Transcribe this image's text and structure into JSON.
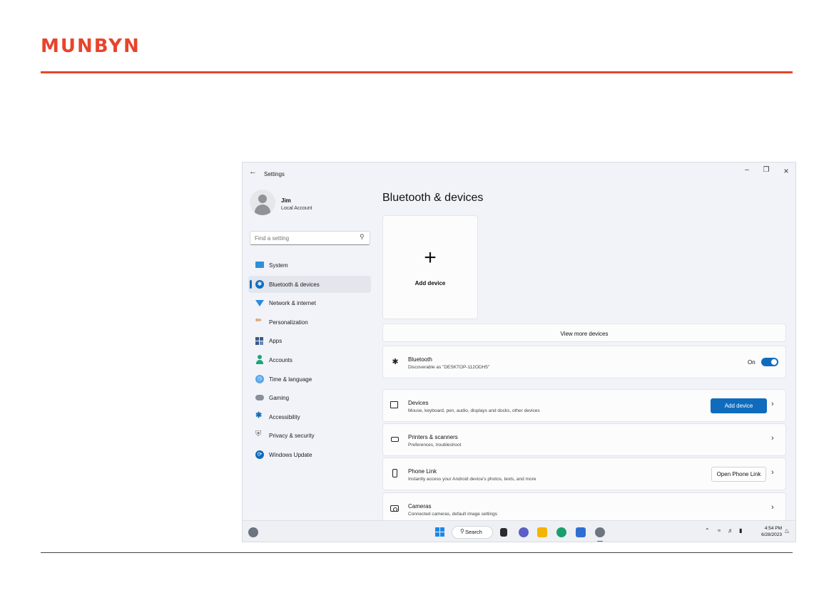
{
  "brand": {
    "logo": "MUNBYN",
    "accent": "#e8442c"
  },
  "window": {
    "title": "Settings",
    "back_icon": "back-arrow-icon",
    "controls": [
      "minimize-icon",
      "maximize-icon",
      "close-icon"
    ]
  },
  "profile": {
    "name": "Jim",
    "account_type": "Local Account"
  },
  "search": {
    "placeholder": "Find a setting"
  },
  "sidebar": {
    "items": [
      {
        "label": "System",
        "icon": "system-icon"
      },
      {
        "label": "Bluetooth & devices",
        "icon": "bluetooth-icon",
        "selected": true
      },
      {
        "label": "Network & internet",
        "icon": "network-icon"
      },
      {
        "label": "Personalization",
        "icon": "brush-icon"
      },
      {
        "label": "Apps",
        "icon": "apps-icon"
      },
      {
        "label": "Accounts",
        "icon": "person-icon"
      },
      {
        "label": "Time & language",
        "icon": "globe-icon"
      },
      {
        "label": "Gaming",
        "icon": "gamepad-icon"
      },
      {
        "label": "Accessibility",
        "icon": "accessibility-icon"
      },
      {
        "label": "Privacy & security",
        "icon": "shield-icon"
      },
      {
        "label": "Windows Update",
        "icon": "update-icon"
      }
    ]
  },
  "main": {
    "title": "Bluetooth & devices",
    "add_tile": {
      "label": "Add device",
      "icon": "plus-icon"
    },
    "view_more": "View more devices",
    "bluetooth": {
      "title": "Bluetooth",
      "subtitle": "Discoverable as \"DESKTOP-112ODH5\"",
      "toggle_label": "On",
      "enabled": true
    },
    "rows": [
      {
        "title": "Devices",
        "subtitle": "Mouse, keyboard, pen, audio, displays and docks, other devices",
        "button": "Add device",
        "icon": "devices-icon"
      },
      {
        "title": "Printers & scanners",
        "subtitle": "Preferences, troubleshoot",
        "icon": "printer-icon"
      },
      {
        "title": "Phone Link",
        "subtitle": "Instantly access your Android device's photos, texts, and more",
        "button": "Open Phone Link",
        "icon": "phone-icon"
      },
      {
        "title": "Cameras",
        "subtitle": "Connected cameras, default image settings",
        "icon": "camera-icon"
      }
    ]
  },
  "taskbar": {
    "search_label": "Search",
    "time": "4:54 PM",
    "date": "6/28/2023",
    "apps": [
      "file-explorer-icon",
      "teams-icon",
      "folder-icon",
      "edge-icon",
      "store-icon",
      "settings-icon"
    ]
  },
  "colors": {
    "accent_blue": "#0f6cbd",
    "window_bg": "#f1f3f8"
  }
}
